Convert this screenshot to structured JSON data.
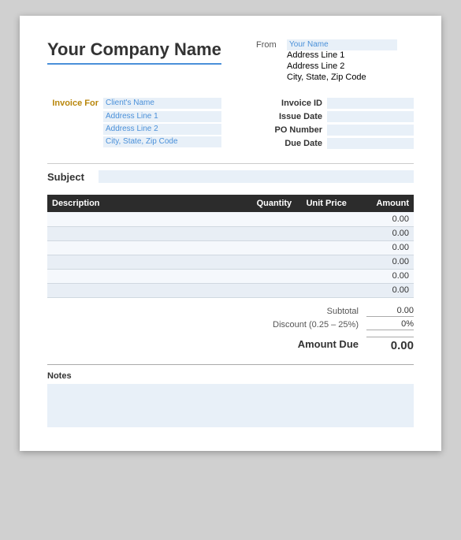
{
  "company": {
    "name": "Your Company Name"
  },
  "from": {
    "label": "From",
    "name_value": "Your Name",
    "address1": "Address Line 1",
    "address2": "Address Line 2",
    "city_state_zip": "City, State, Zip Code"
  },
  "invoice_for": {
    "label": "Invoice For",
    "client_name": "Client's Name",
    "address1": "Address Line 1",
    "address2": "Address Line 2",
    "city_state_zip": "City, State, Zip Code"
  },
  "invoice_details": {
    "invoice_id_label": "Invoice ID",
    "issue_date_label": "Issue Date",
    "po_number_label": "PO Number",
    "due_date_label": "Due Date"
  },
  "subject": {
    "label": "Subject"
  },
  "table": {
    "headers": {
      "description": "Description",
      "quantity": "Quantity",
      "unit_price": "Unit Price",
      "amount": "Amount"
    },
    "rows": [
      {
        "description": "",
        "quantity": "",
        "unit_price": "",
        "amount": "0.00"
      },
      {
        "description": "",
        "quantity": "",
        "unit_price": "",
        "amount": "0.00"
      },
      {
        "description": "",
        "quantity": "",
        "unit_price": "",
        "amount": "0.00"
      },
      {
        "description": "",
        "quantity": "",
        "unit_price": "",
        "amount": "0.00"
      },
      {
        "description": "",
        "quantity": "",
        "unit_price": "",
        "amount": "0.00"
      },
      {
        "description": "",
        "quantity": "",
        "unit_price": "",
        "amount": "0.00"
      }
    ]
  },
  "totals": {
    "subtotal_label": "Subtotal",
    "subtotal_value": "0.00",
    "discount_label": "Discount (0.25 – 25%)",
    "discount_value": "0%",
    "amount_due_label": "Amount Due",
    "amount_due_value": "0.00"
  },
  "notes": {
    "label": "Notes"
  }
}
